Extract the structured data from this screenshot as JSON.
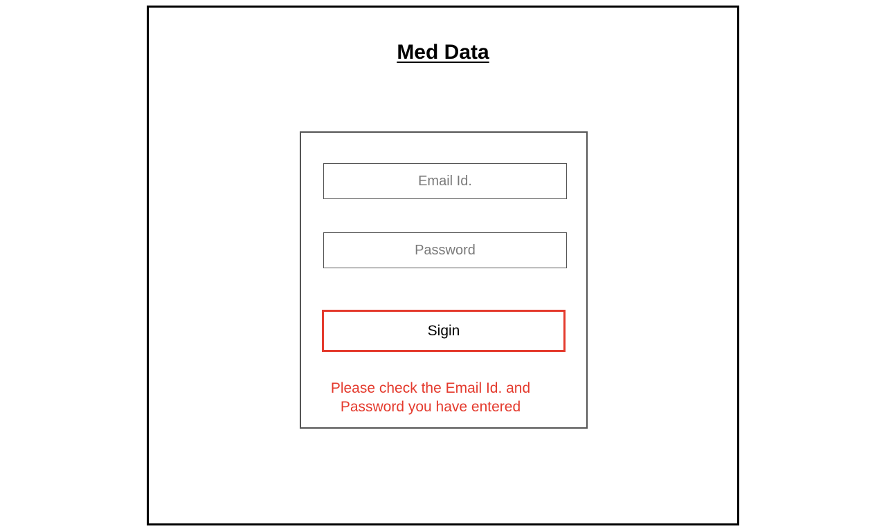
{
  "header": {
    "title": "Med Data"
  },
  "login": {
    "email_placeholder": "Email Id.",
    "email_value": "",
    "password_placeholder": "Password",
    "password_value": "",
    "signin_label": "Sigin",
    "error_lines": [
      "Please check the Email Id. and",
      "Password you have entered"
    ]
  },
  "colors": {
    "error": "#e43a2d",
    "frame_border": "#000000",
    "box_border": "#555555",
    "placeholder": "#7a7a7a"
  }
}
